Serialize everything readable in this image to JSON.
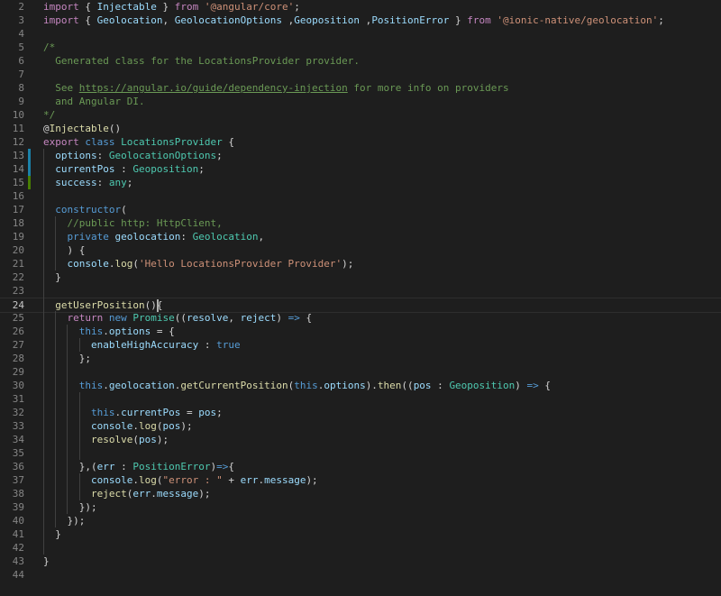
{
  "editor": {
    "colors": {
      "background": "#1e1e1e",
      "keyword_control": "#c586c0",
      "keyword": "#569cd6",
      "string": "#ce9178",
      "comment": "#6a9955",
      "type": "#4ec9b0",
      "function": "#dcdcaa",
      "variable": "#9cdcfe",
      "text": "#d4d4d4",
      "line_number": "#858585",
      "modified_marker": "#1b81a8",
      "added_marker": "#487e02"
    },
    "active_line": 24,
    "lines": [
      {
        "n": "2",
        "tokens": [
          [
            "kw",
            "import"
          ],
          [
            "pn",
            " { "
          ],
          [
            "var",
            "Injectable"
          ],
          [
            "pn",
            " } "
          ],
          [
            "kw",
            "from"
          ],
          [
            "pn",
            " "
          ],
          [
            "str",
            "'@angular/core'"
          ],
          [
            "pn",
            ";"
          ]
        ]
      },
      {
        "n": "3",
        "tokens": [
          [
            "kw",
            "import"
          ],
          [
            "pn",
            " { "
          ],
          [
            "var",
            "Geolocation"
          ],
          [
            "pn",
            ", "
          ],
          [
            "var",
            "GeolocationOptions"
          ],
          [
            "pn",
            " ,"
          ],
          [
            "var",
            "Geoposition"
          ],
          [
            "pn",
            " ,"
          ],
          [
            "var",
            "PositionError"
          ],
          [
            "pn",
            " } "
          ],
          [
            "kw",
            "from"
          ],
          [
            "pn",
            " "
          ],
          [
            "str",
            "'@ionic-native/geolocation'"
          ],
          [
            "pn",
            ";"
          ]
        ]
      },
      {
        "n": "4",
        "tokens": []
      },
      {
        "n": "5",
        "tokens": [
          [
            "cm",
            "/*"
          ]
        ]
      },
      {
        "n": "6",
        "tokens": [
          [
            "cm",
            "  Generated class for the LocationsProvider provider."
          ]
        ]
      },
      {
        "n": "7",
        "tokens": []
      },
      {
        "n": "8",
        "tokens": [
          [
            "cm",
            "  See "
          ],
          [
            "lnk",
            "https://angular.io/guide/dependency-injection"
          ],
          [
            "cm",
            " for more info on providers"
          ]
        ]
      },
      {
        "n": "9",
        "tokens": [
          [
            "cm",
            "  and Angular DI."
          ]
        ]
      },
      {
        "n": "10",
        "tokens": [
          [
            "cm",
            "*/"
          ]
        ]
      },
      {
        "n": "11",
        "tokens": [
          [
            "pn",
            "@"
          ],
          [
            "fn",
            "Injectable"
          ],
          [
            "pn",
            "()"
          ]
        ]
      },
      {
        "n": "12",
        "tokens": [
          [
            "kw",
            "export"
          ],
          [
            "pn",
            " "
          ],
          [
            "kw2",
            "class"
          ],
          [
            "pn",
            " "
          ],
          [
            "cls",
            "LocationsProvider"
          ],
          [
            "pn",
            " {"
          ]
        ]
      },
      {
        "n": "13",
        "mark": "mod",
        "tokens": [
          [
            "pn",
            "  "
          ],
          [
            "var",
            "options"
          ],
          [
            "pn",
            ": "
          ],
          [
            "cls",
            "GeolocationOptions"
          ],
          [
            "pn",
            ";"
          ]
        ]
      },
      {
        "n": "14",
        "mark": "mod",
        "tokens": [
          [
            "pn",
            "  "
          ],
          [
            "var",
            "currentPos"
          ],
          [
            "pn",
            " : "
          ],
          [
            "cls",
            "Geoposition"
          ],
          [
            "pn",
            ";"
          ]
        ]
      },
      {
        "n": "15",
        "mark": "add",
        "tokens": [
          [
            "pn",
            "  "
          ],
          [
            "var",
            "success"
          ],
          [
            "pn",
            ": "
          ],
          [
            "cls",
            "any"
          ],
          [
            "pn",
            ";"
          ]
        ]
      },
      {
        "n": "16",
        "tokens": []
      },
      {
        "n": "17",
        "tokens": [
          [
            "pn",
            "  "
          ],
          [
            "kw2",
            "constructor"
          ],
          [
            "pn",
            "("
          ]
        ]
      },
      {
        "n": "18",
        "tokens": [
          [
            "pn",
            "    "
          ],
          [
            "cm",
            "//public http: HttpClient,"
          ]
        ]
      },
      {
        "n": "19",
        "tokens": [
          [
            "pn",
            "    "
          ],
          [
            "kw2",
            "private"
          ],
          [
            "pn",
            " "
          ],
          [
            "var",
            "geolocation"
          ],
          [
            "pn",
            ": "
          ],
          [
            "cls",
            "Geolocation"
          ],
          [
            "pn",
            ","
          ]
        ]
      },
      {
        "n": "20",
        "tokens": [
          [
            "pn",
            "    ) {"
          ]
        ]
      },
      {
        "n": "21",
        "tokens": [
          [
            "pn",
            "    "
          ],
          [
            "var",
            "console"
          ],
          [
            "pn",
            "."
          ],
          [
            "fn",
            "log"
          ],
          [
            "pn",
            "("
          ],
          [
            "str",
            "'Hello LocationsProvider Provider'"
          ],
          [
            "pn",
            ");"
          ]
        ]
      },
      {
        "n": "22",
        "tokens": [
          [
            "pn",
            "  }"
          ]
        ]
      },
      {
        "n": "23",
        "tokens": []
      },
      {
        "n": "24",
        "tokens": [
          [
            "pn",
            "  "
          ],
          [
            "fn",
            "getUserPosition"
          ],
          [
            "pn",
            "(){"
          ]
        ]
      },
      {
        "n": "25",
        "tokens": [
          [
            "pn",
            "    "
          ],
          [
            "kw",
            "return"
          ],
          [
            "pn",
            " "
          ],
          [
            "kw2",
            "new"
          ],
          [
            "pn",
            " "
          ],
          [
            "cls",
            "Promise"
          ],
          [
            "pn",
            "(("
          ],
          [
            "var",
            "resolve"
          ],
          [
            "pn",
            ", "
          ],
          [
            "var",
            "reject"
          ],
          [
            "pn",
            ") "
          ],
          [
            "kw2",
            "=>"
          ],
          [
            "pn",
            " {"
          ]
        ]
      },
      {
        "n": "26",
        "tokens": [
          [
            "pn",
            "      "
          ],
          [
            "kw2",
            "this"
          ],
          [
            "pn",
            "."
          ],
          [
            "var",
            "options"
          ],
          [
            "pn",
            " = {"
          ]
        ]
      },
      {
        "n": "27",
        "tokens": [
          [
            "pn",
            "        "
          ],
          [
            "var",
            "enableHighAccuracy"
          ],
          [
            "pn",
            " : "
          ],
          [
            "kw2",
            "true"
          ]
        ]
      },
      {
        "n": "28",
        "tokens": [
          [
            "pn",
            "      };"
          ]
        ]
      },
      {
        "n": "29",
        "tokens": []
      },
      {
        "n": "30",
        "tokens": [
          [
            "pn",
            "      "
          ],
          [
            "kw2",
            "this"
          ],
          [
            "pn",
            "."
          ],
          [
            "var",
            "geolocation"
          ],
          [
            "pn",
            "."
          ],
          [
            "fn",
            "getCurrentPosition"
          ],
          [
            "pn",
            "("
          ],
          [
            "kw2",
            "this"
          ],
          [
            "pn",
            "."
          ],
          [
            "var",
            "options"
          ],
          [
            "pn",
            ")."
          ],
          [
            "fn",
            "then"
          ],
          [
            "pn",
            "(("
          ],
          [
            "var",
            "pos"
          ],
          [
            "pn",
            " : "
          ],
          [
            "cls",
            "Geoposition"
          ],
          [
            "pn",
            ") "
          ],
          [
            "kw2",
            "=>"
          ],
          [
            "pn",
            " {"
          ]
        ]
      },
      {
        "n": "31",
        "tokens": []
      },
      {
        "n": "32",
        "tokens": [
          [
            "pn",
            "        "
          ],
          [
            "kw2",
            "this"
          ],
          [
            "pn",
            "."
          ],
          [
            "var",
            "currentPos"
          ],
          [
            "pn",
            " = "
          ],
          [
            "var",
            "pos"
          ],
          [
            "pn",
            ";"
          ]
        ]
      },
      {
        "n": "33",
        "tokens": [
          [
            "pn",
            "        "
          ],
          [
            "var",
            "console"
          ],
          [
            "pn",
            "."
          ],
          [
            "fn",
            "log"
          ],
          [
            "pn",
            "("
          ],
          [
            "var",
            "pos"
          ],
          [
            "pn",
            ");"
          ]
        ]
      },
      {
        "n": "34",
        "tokens": [
          [
            "pn",
            "        "
          ],
          [
            "fn",
            "resolve"
          ],
          [
            "pn",
            "("
          ],
          [
            "var",
            "pos"
          ],
          [
            "pn",
            ");"
          ]
        ]
      },
      {
        "n": "35",
        "tokens": []
      },
      {
        "n": "36",
        "tokens": [
          [
            "pn",
            "      },("
          ],
          [
            "var",
            "err"
          ],
          [
            "pn",
            " : "
          ],
          [
            "cls",
            "PositionError"
          ],
          [
            "pn",
            ")"
          ],
          [
            "kw2",
            "=>"
          ],
          [
            "pn",
            "{"
          ]
        ]
      },
      {
        "n": "37",
        "tokens": [
          [
            "pn",
            "        "
          ],
          [
            "var",
            "console"
          ],
          [
            "pn",
            "."
          ],
          [
            "fn",
            "log"
          ],
          [
            "pn",
            "("
          ],
          [
            "str",
            "\"error : \""
          ],
          [
            "pn",
            " + "
          ],
          [
            "var",
            "err"
          ],
          [
            "pn",
            "."
          ],
          [
            "var",
            "message"
          ],
          [
            "pn",
            ");"
          ]
        ]
      },
      {
        "n": "38",
        "tokens": [
          [
            "pn",
            "        "
          ],
          [
            "fn",
            "reject"
          ],
          [
            "pn",
            "("
          ],
          [
            "var",
            "err"
          ],
          [
            "pn",
            "."
          ],
          [
            "var",
            "message"
          ],
          [
            "pn",
            ");"
          ]
        ]
      },
      {
        "n": "39",
        "tokens": [
          [
            "pn",
            "      });"
          ]
        ]
      },
      {
        "n": "40",
        "tokens": [
          [
            "pn",
            "    });"
          ]
        ]
      },
      {
        "n": "41",
        "tokens": [
          [
            "pn",
            "  }"
          ]
        ]
      },
      {
        "n": "42",
        "tokens": []
      },
      {
        "n": "43",
        "tokens": [
          [
            "pn",
            "}"
          ]
        ]
      },
      {
        "n": "44",
        "tokens": []
      }
    ]
  }
}
